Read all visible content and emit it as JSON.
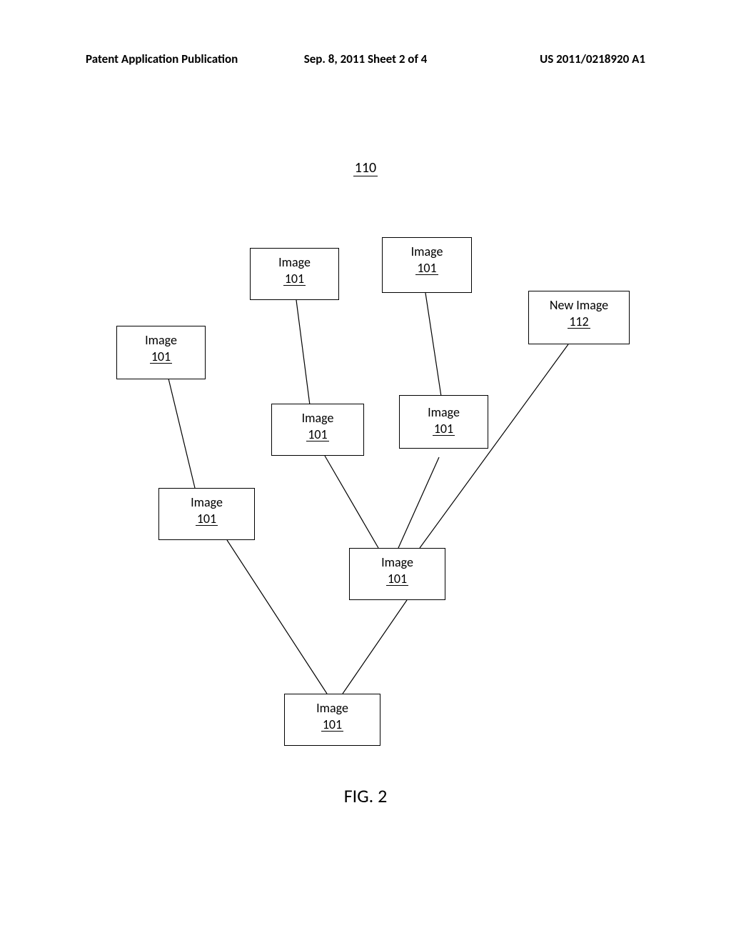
{
  "header": {
    "left": "Patent Application Publication",
    "center": "Sep. 8, 2011  Sheet 2 of 4",
    "right": "US 2011/0218920 A1"
  },
  "diagram": {
    "top_ref": "110",
    "nodes": {
      "a": {
        "label": "Image",
        "ref": "101"
      },
      "b": {
        "label": "Image",
        "ref": "101"
      },
      "c": {
        "label": "New Image",
        "ref": "112"
      },
      "d": {
        "label": "Image",
        "ref": "101"
      },
      "e": {
        "label": "Image",
        "ref": "101"
      },
      "f": {
        "label": "Image",
        "ref": "101"
      },
      "g": {
        "label": "Image",
        "ref": "101"
      },
      "h": {
        "label": "Image",
        "ref": "101"
      },
      "i": {
        "label": "Image",
        "ref": "101"
      }
    },
    "figure_caption": "FIG. 2"
  }
}
